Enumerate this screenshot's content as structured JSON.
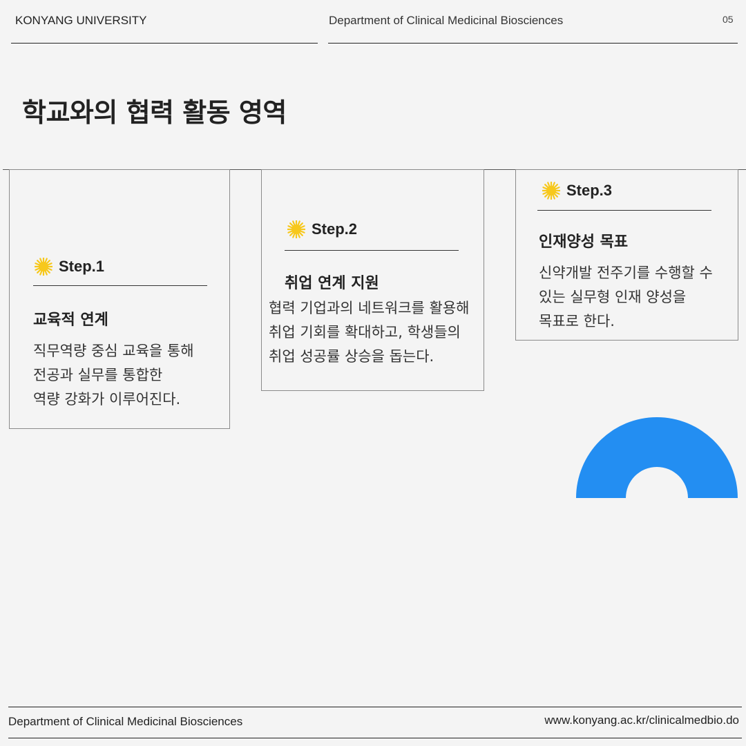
{
  "header": {
    "left": "KONYANG UNIVERSITY",
    "center": "Department of Clinical Medicinal Biosciences",
    "page_number": "05"
  },
  "title": "학교와의 협력 활동 영역",
  "steps": [
    {
      "step": "Step.1",
      "heading": "교육적 연계",
      "body": [
        "직무역량 중심 교육을 통해",
        "전공과 실무를 통합한",
        "역량 강화가 이루어진다."
      ]
    },
    {
      "step": "Step.2",
      "heading": "취업 연계 지원",
      "body": [
        "협력 기업과의 네트워크를 활용해",
        "취업 기회를 확대하고, 학생들의",
        "취업 성공률 상승을 돕는다."
      ]
    },
    {
      "step": "Step.3",
      "heading": "인재양성 목표",
      "body": [
        "신약개발 전주기를 수행할 수",
        "있는 실무형 인재 양성을",
        "목표로 한다."
      ]
    }
  ],
  "footer": {
    "left": "Department of Clinical Medicinal Biosciences",
    "right": "www.konyang.ac.kr/clinicalmedbio.do"
  },
  "colors": {
    "accent_blue": "#238ef2",
    "sun_yellow": "#f7c81c",
    "background": "#f4f4f4"
  },
  "icons": [
    "sun-icon",
    "half-ring-graphic"
  ]
}
